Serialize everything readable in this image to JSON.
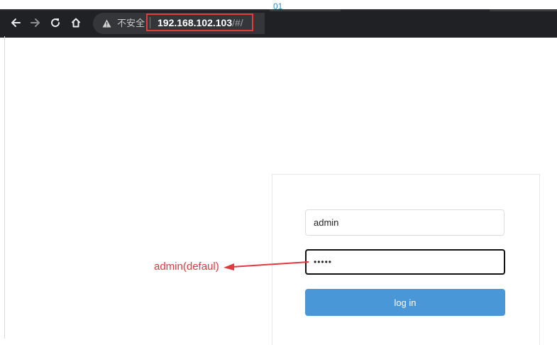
{
  "step": "01",
  "browser": {
    "security_label": "不安全",
    "url_host": "192.168.102.103",
    "url_hash": "/#/"
  },
  "login": {
    "username_value": "admin",
    "password_value": "•••••",
    "button_label": "log in"
  },
  "annotation": {
    "text": "admin(defaul)",
    "color": "#e0393e"
  },
  "icons": [
    "back-arrow-icon",
    "forward-arrow-icon",
    "reload-icon",
    "home-icon",
    "warning-icon"
  ]
}
